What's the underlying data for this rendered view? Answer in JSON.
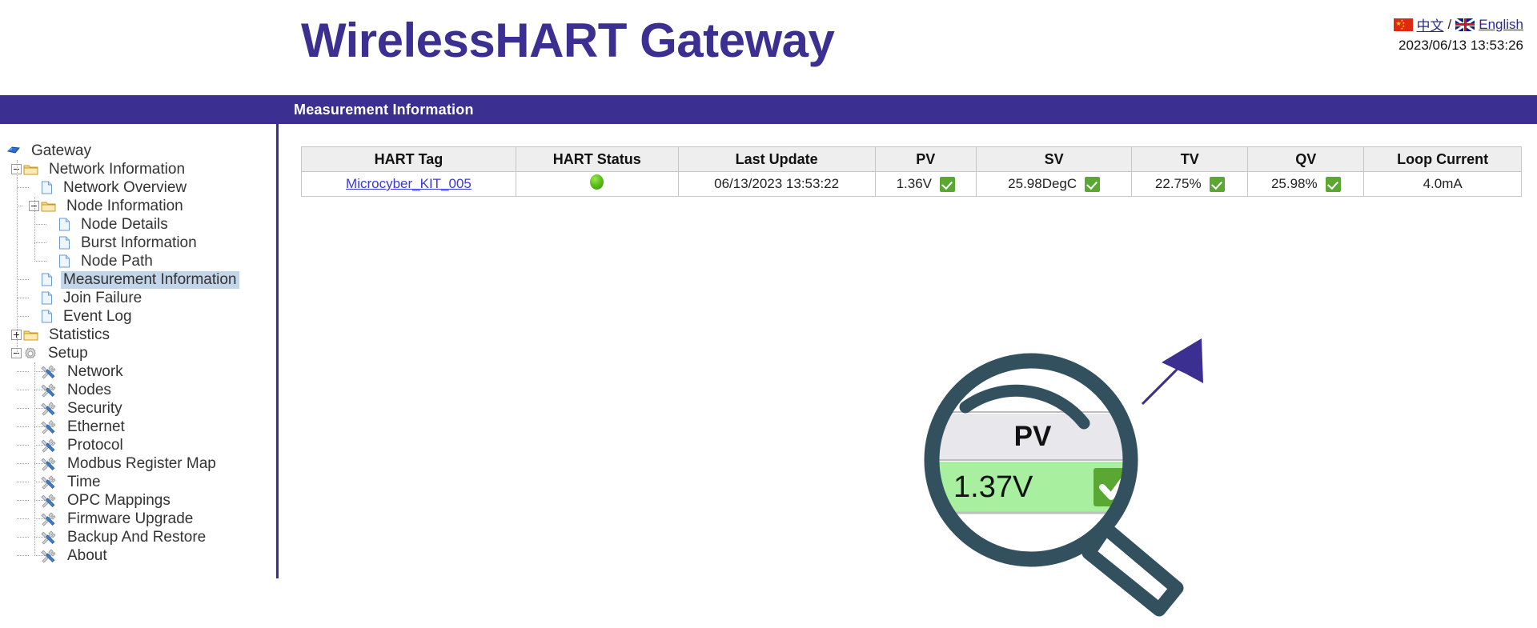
{
  "header": {
    "title": "WirelessHART Gateway",
    "lang": {
      "chinese_label": "中文",
      "separator": "/",
      "english_label": "English",
      "cn_flag_icon": "china-flag-icon",
      "uk_flag_icon": "uk-flag-icon"
    },
    "datetime": "2023/06/13 13:53:26"
  },
  "band": {
    "title": "Measurement Information",
    "color": "#3b2f91"
  },
  "sidebar": {
    "root": {
      "label": "Gateway",
      "icon": "gateway-gem-icon"
    },
    "items": [
      {
        "label": "Network Information",
        "icon": "folder-icon",
        "expander": "minus",
        "depth": 1
      },
      {
        "label": "Network Overview",
        "icon": "page-icon",
        "expander": "none",
        "depth": 2
      },
      {
        "label": "Node Information",
        "icon": "folder-icon",
        "expander": "minus",
        "depth": 2
      },
      {
        "label": "Node Details",
        "icon": "page-icon",
        "expander": "none",
        "depth": 3
      },
      {
        "label": "Burst Information",
        "icon": "page-icon",
        "expander": "none",
        "depth": 3
      },
      {
        "label": "Node Path",
        "icon": "page-icon",
        "expander": "none",
        "depth": 3
      },
      {
        "label": "Measurement Information",
        "icon": "page-icon",
        "expander": "none",
        "depth": 2,
        "selected": true
      },
      {
        "label": "Join Failure",
        "icon": "page-icon",
        "expander": "none",
        "depth": 2
      },
      {
        "label": "Event Log",
        "icon": "page-icon",
        "expander": "none",
        "depth": 2
      },
      {
        "label": "Statistics",
        "icon": "folder-icon",
        "expander": "plus",
        "depth": 1
      },
      {
        "label": "Setup",
        "icon": "gear-icon",
        "expander": "minus",
        "depth": 1
      },
      {
        "label": "Network",
        "icon": "tools-icon",
        "expander": "none",
        "depth": 2
      },
      {
        "label": "Nodes",
        "icon": "tools-icon",
        "expander": "none",
        "depth": 2
      },
      {
        "label": "Security",
        "icon": "tools-icon",
        "expander": "none",
        "depth": 2
      },
      {
        "label": "Ethernet",
        "icon": "tools-icon",
        "expander": "none",
        "depth": 2
      },
      {
        "label": "Protocol",
        "icon": "tools-icon",
        "expander": "none",
        "depth": 2
      },
      {
        "label": "Modbus Register Map",
        "icon": "tools-icon",
        "expander": "none",
        "depth": 2
      },
      {
        "label": "Time",
        "icon": "tools-icon",
        "expander": "none",
        "depth": 2
      },
      {
        "label": "OPC Mappings",
        "icon": "tools-icon",
        "expander": "none",
        "depth": 2
      },
      {
        "label": "Firmware Upgrade",
        "icon": "tools-icon",
        "expander": "none",
        "depth": 2
      },
      {
        "label": "Backup And Restore",
        "icon": "tools-icon",
        "expander": "none",
        "depth": 2
      },
      {
        "label": "About",
        "icon": "tools-icon",
        "expander": "none",
        "depth": 2
      }
    ],
    "selected_highlight_color": "#c3d5e8"
  },
  "table": {
    "columns": [
      "HART Tag",
      "HART Status",
      "Last Update",
      "PV",
      "SV",
      "TV",
      "QV",
      "Loop Current"
    ],
    "rows": [
      {
        "hart_tag": "Microcyber_KIT_005",
        "hart_status": "green",
        "last_update": "06/13/2023 13:53:22",
        "pv": "1.36V",
        "pv_ok": true,
        "sv": "25.98DegC",
        "sv_ok": true,
        "tv": "22.75%",
        "tv_ok": true,
        "qv": "25.98%",
        "qv_ok": true,
        "loop_current": "4.0mA"
      }
    ]
  },
  "magnifier": {
    "header_label": "PV",
    "value": "1.37V",
    "value_ok": true,
    "ring_color": "#33505f",
    "value_bg_color": "#a8f0a0",
    "check_color": "#5aa832",
    "arrow_color": "#3b2f91"
  }
}
